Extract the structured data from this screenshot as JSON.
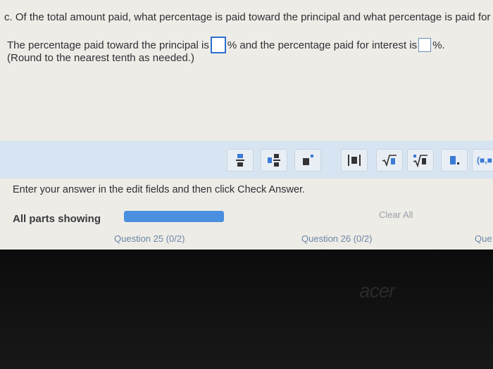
{
  "question": {
    "text": "c. Of the total amount paid, what percentage is paid toward the principal and what percentage is paid for",
    "line_a": "The percentage paid toward the principal is",
    "line_b": "% and the percentage paid for interest is",
    "line_c": "%.",
    "round_note": "(Round to the nearest tenth as needed.)"
  },
  "toolbar": {
    "buttons": [
      {
        "name": "fraction-icon"
      },
      {
        "name": "mixed-number-icon"
      },
      {
        "name": "exponent-icon"
      },
      {
        "name": "absolute-value-icon"
      },
      {
        "name": "square-root-icon"
      },
      {
        "name": "nth-root-icon"
      },
      {
        "name": "decimal-icon"
      },
      {
        "name": "interval-icon",
        "label": "(■,■"
      }
    ]
  },
  "instruction": "Enter your answer in the edit fields and then click Check Answer.",
  "status": {
    "all_parts": "All parts showing",
    "progress": 1.0,
    "clear_all": "Clear All"
  },
  "nav": {
    "q25": "Question 25 (0/2)",
    "q26": "Question 26 (0/2)",
    "q27": "Que"
  },
  "brand": "acer",
  "colors": {
    "accent": "#4a8fe0",
    "toolbar_bg": "#d7e4f1",
    "page_bg": "#eeece6"
  }
}
